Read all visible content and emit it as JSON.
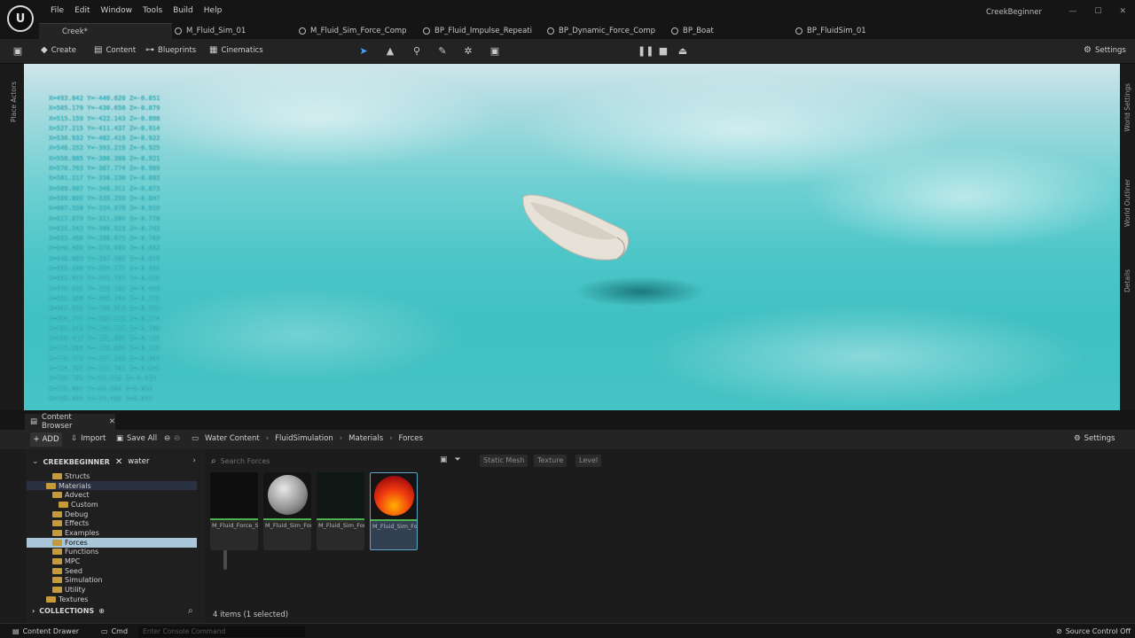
{
  "app": {
    "logo_text": "U",
    "project_name": "CreekBeginner",
    "menu": [
      "File",
      "Edit",
      "Window",
      "Tools",
      "Build",
      "Help"
    ],
    "window_controls": [
      "—",
      "☐",
      "✕"
    ]
  },
  "tabs": [
    {
      "label": "Creek*",
      "icon": "level-icon",
      "active": true
    },
    {
      "label": "M_Fluid_Sim_01",
      "icon": "material-icon"
    },
    {
      "label": "M_Fluid_Sim_Force_Comp",
      "icon": "material-icon"
    },
    {
      "label": "BP_Fluid_Impulse_Repeati",
      "icon": "blueprint-icon"
    },
    {
      "label": "BP_Dynamic_Force_Comp",
      "icon": "blueprint-icon"
    },
    {
      "label": "BP_Boat",
      "icon": "blueprint-icon"
    },
    {
      "label": "BP_FluidSim_01",
      "icon": "blueprint-icon"
    }
  ],
  "toolbar": {
    "create_label": "Create",
    "content_label": "Content",
    "blueprints_label": "Blueprints",
    "cinematics_label": "Cinematics",
    "settings_label": "Settings"
  },
  "side_panels": {
    "place_actors": "Place Actors",
    "world_settings": "World Settings",
    "world_outliner": "World Outliner",
    "details": "Details"
  },
  "viewport": {
    "log_lines": [
      "X=493.042 Y=-440.620 Z=-0.851",
      "X=505.179 Y=-430.650 Z=-0.879",
      "X=515.159 Y=-422.143 Z=-0.898",
      "X=527.215 Y=-411.437 Z=-0.914",
      "X=536.932 Y=-402.419 Z=-0.922",
      "X=546.252 Y=-393.219 Z=-0.925",
      "X=558.885 Y=-380.398 Z=-0.921",
      "X=570.763 Y=-367.774 Z=-0.909",
      "X=581.217 Y=-356.230 Z=-0.892",
      "X=589.907 Y=-346.311 Z=-0.873",
      "X=599.005 Y=-335.259 Z=-0.847",
      "X=607.350 Y=-324.978 Z=-0.819",
      "X=617.679 Y=-311.594 Z=-0.778",
      "X=625.542 Y=-300.923 Z=-0.743",
      "X=633.488 Y=-289.675 Z=-0.703",
      "X=640.489 Y=-279.669 Z=-0.662",
      "X=648.083 Y=-267.565 Z=-0.619",
      "X=655.290 Y=-254.175 Z=-0.565",
      "X=663.023 Y=-242.797 Z=-0.518",
      "X=670.665 Y=-229.182 Z=-0.463",
      "X=681.500 Y=-208.704 Z=-0.379",
      "X=687.625 Y=-196.913 Z=-0.331",
      "X=694.777 Y=-182.223 Z=-0.274",
      "X=702.848 Y=-164.737 Z=-0.200",
      "X=708.413 Y=-151.089 Z=-0.155",
      "X=713.690 Y=-139.830 Z=-0.125",
      "X=718.479 Y=-127.263 Z=-0.087",
      "X=724.295 Y=-111.701 Z=-0.045",
      "X=729.765 Y=-99.256 Z=-0.014",
      "X=733.084 Y=-85.509 Z=0.016",
      "X=739.064 Y=-72.485 Z=0.047"
    ]
  },
  "content_browser": {
    "tab_label": "Content Browser",
    "add_label": "ADD",
    "import_label": "Import",
    "save_all_label": "Save All",
    "settings_label": "Settings",
    "breadcrumb": [
      "Water Content",
      "FluidSimulation",
      "Materials",
      "Forces"
    ],
    "tree_root": "CREEKBEGINNER",
    "filter_text": "water",
    "tree": [
      {
        "label": "Structs",
        "indent": 3
      },
      {
        "label": "Materials",
        "indent": 2,
        "highlight": true
      },
      {
        "label": "Advect",
        "indent": 3
      },
      {
        "label": "Custom",
        "indent": 4
      },
      {
        "label": "Debug",
        "indent": 3
      },
      {
        "label": "Effects",
        "indent": 3
      },
      {
        "label": "Examples",
        "indent": 3
      },
      {
        "label": "Forces",
        "indent": 3,
        "selected": true
      },
      {
        "label": "Functions",
        "indent": 3
      },
      {
        "label": "MPC",
        "indent": 3
      },
      {
        "label": "Seed",
        "indent": 3
      },
      {
        "label": "Simulation",
        "indent": 3
      },
      {
        "label": "Utility",
        "indent": 3
      },
      {
        "label": "Textures",
        "indent": 2
      }
    ],
    "collections_label": "COLLECTIONS",
    "search_placeholder": "Search Forces",
    "filter_chips": [
      "Static Mesh",
      "Texture",
      "Level"
    ],
    "assets": [
      {
        "label": "M_Fluid_Force_SkelMesh",
        "thumb": "dark"
      },
      {
        "label": "M_Fluid_Sim_Force_Boat_Component",
        "thumb": "sphere"
      },
      {
        "label": "M_Fluid_Sim_Force_Component",
        "thumb": "dark"
      },
      {
        "label": "M_Fluid_Sim_Force_Impulse",
        "thumb": "red",
        "selected": true
      }
    ],
    "item_count": "4 items (1 selected)"
  },
  "statusbar": {
    "content_drawer": "Content Drawer",
    "cmd": "Cmd",
    "console_placeholder": "Enter Console Command",
    "source_control": "Source Control Off"
  }
}
